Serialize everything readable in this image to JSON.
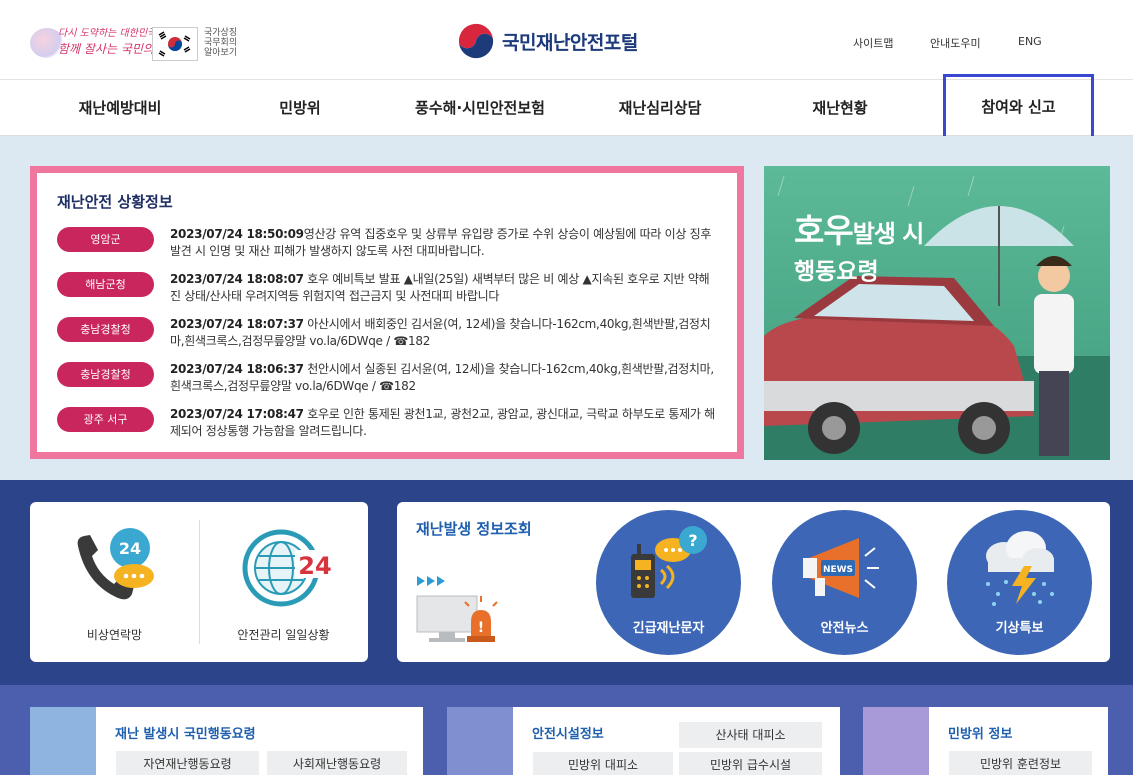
{
  "header": {
    "slogan_line1": "다시 도약하는 대한민국",
    "slogan_line2": "함께 잘사는 국민의 나라",
    "gov_link": "국가상징 국무회의 알아보기",
    "logo_text": "국민재난안전포털",
    "util": [
      "사이트맵",
      "안내도우미",
      "ENG"
    ]
  },
  "nav": {
    "items": [
      "재난예방대비",
      "민방위",
      "풍수해·시민안전보험",
      "재난심리상담",
      "재난현황",
      "참여와 신고"
    ],
    "active_index": 5,
    "active_color": "#3a47d1"
  },
  "situation": {
    "title": "재난안전 상황정보",
    "badge_color": "#c8265d",
    "border_color": "#f0769e",
    "items": [
      {
        "source": "영암군",
        "time": "2023/07/24 18:50:09",
        "text": "영산강 유역 집중호우 및 상류부 유입량 증가로 수위 상승이 예상됨에 따라 이상 징후 발견 시 인명 및 재산 피해가 발생하지 않도록 사전 대피바랍니다."
      },
      {
        "source": "해남군청",
        "time": "2023/07/24 18:08:07",
        "text": " 호우 예비특보 발표 ▲내일(25일) 새벽부터 많은 비 예상 ▲지속된 호우로 지반 약해진 상태/산사태 우려지역등 위험지역 접근금지 및 사전대피 바랍니다"
      },
      {
        "source": "충남경찰청",
        "time": "2023/07/24 18:07:37",
        "text": " 아산시에서 배회중인 김서윤(여, 12세)을 찾습니다-162cm,40kg,흰색반팔,검정치마,흰색크록스,검정무릎양말 vo.la/6DWqe / ☎182"
      },
      {
        "source": "충남경찰청",
        "time": "2023/07/24 18:06:37",
        "text": " 천안시에서 실종된 김서윤(여, 12세)을 찾습니다-162cm,40kg,흰색반팔,검정치마,흰색크록스,검정무릎양말 vo.la/6DWqe / ☎182"
      },
      {
        "source": "광주 서구",
        "time": "2023/07/24 17:08:47",
        "text": " 호우로 인한 통제된 광천1교, 광천2교, 광암교, 광신대교, 극락교 하부도로 통제가 해제되어 정상통행 가능함을 알려드립니다."
      }
    ]
  },
  "promo": {
    "line1_big": "호우",
    "line1_small": "발생 시",
    "line2": "행동요령"
  },
  "quick_links": {
    "items": [
      "비상연락망",
      "안전관리 일일상황"
    ],
    "icon_24": "24"
  },
  "disaster_info": {
    "title": "재난발생 정보조회",
    "circles": [
      "긴급재난문자",
      "안전뉴스",
      "기상특보"
    ],
    "news_badge": "NEWS",
    "circle_color": "#3d67b6"
  },
  "bottom": {
    "panel1": {
      "title": "재난 발생시 국민행동요령",
      "buttons": [
        "자연재난행동요령",
        "사회재난행동요령"
      ]
    },
    "panel2": {
      "title": "안전시설정보",
      "buttons": [
        "산사태 대피소",
        "민방위 대피소",
        "민방위 급수시설"
      ]
    },
    "panel3": {
      "title": "민방위 정보",
      "buttons": [
        "민방위 훈련정보"
      ]
    }
  }
}
